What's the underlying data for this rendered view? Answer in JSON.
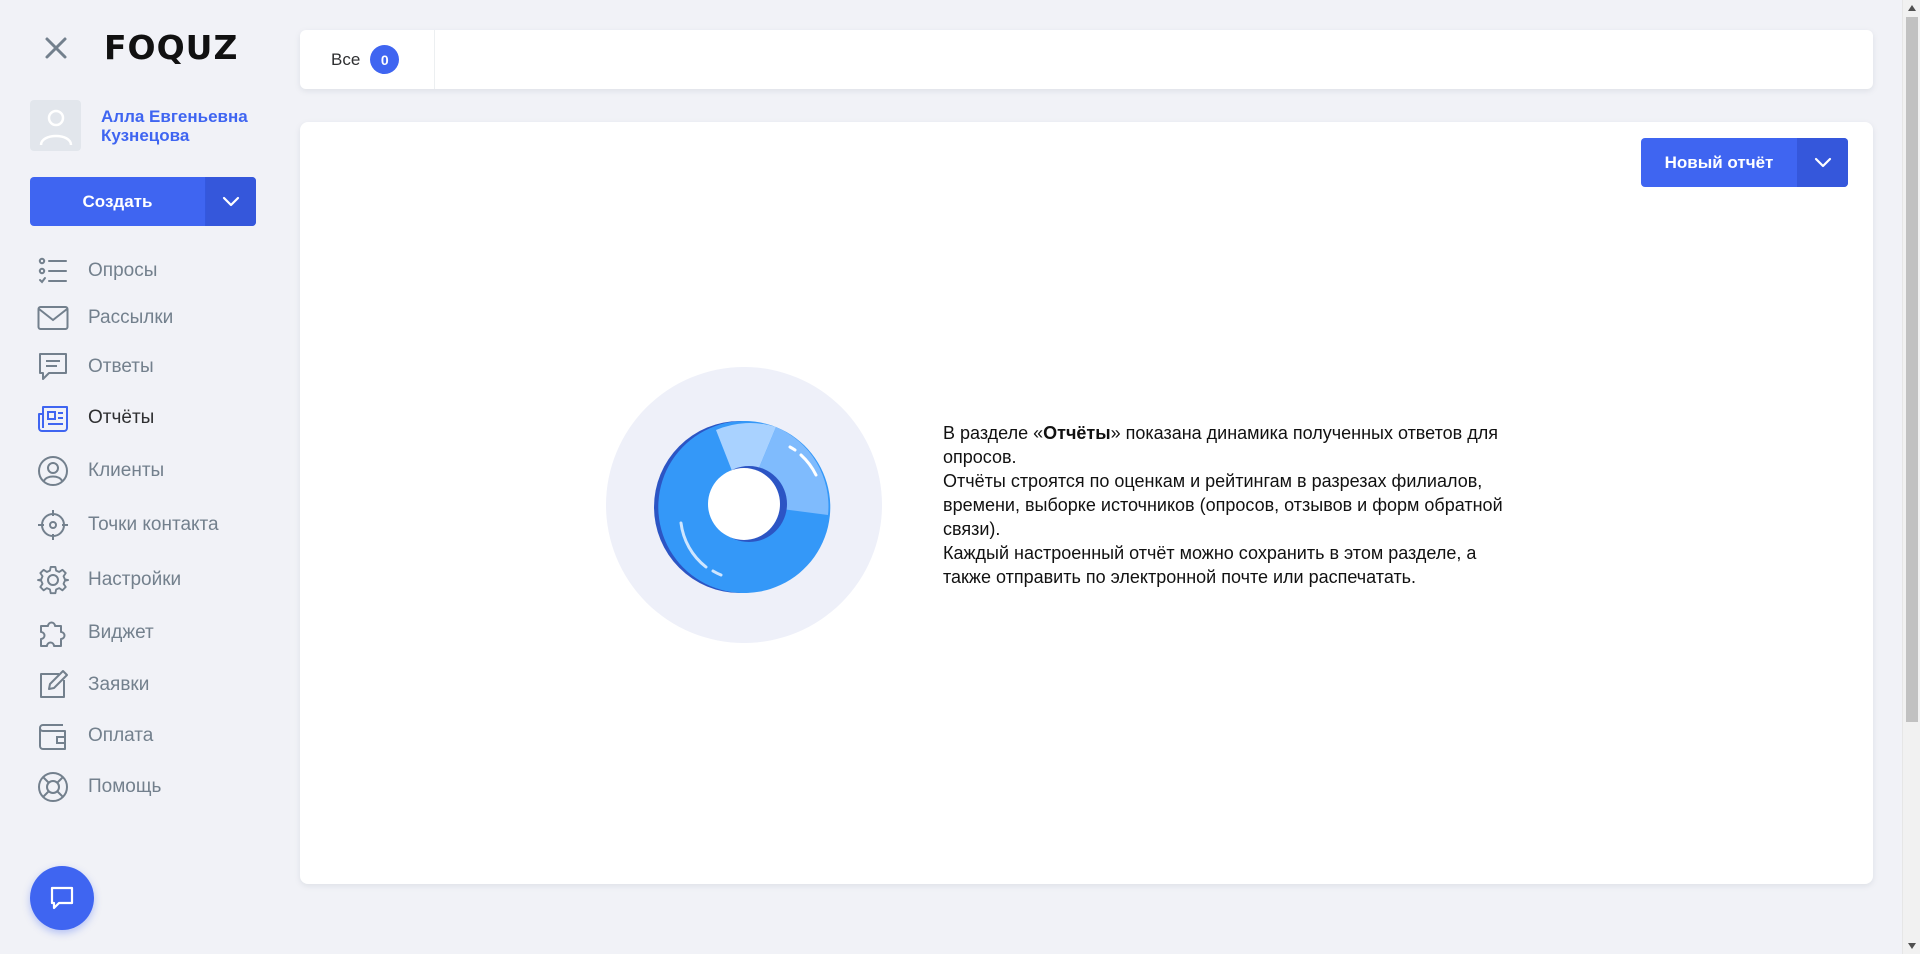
{
  "app": {
    "logo": "FOQUZ"
  },
  "user": {
    "name": "Алла Евгеньевна Кузнецова"
  },
  "create_button": {
    "label": "Создать"
  },
  "nav": {
    "items": [
      {
        "label": "Опросы",
        "icon": "list-check-icon",
        "active": false
      },
      {
        "label": "Рассылки",
        "icon": "mail-icon",
        "active": false
      },
      {
        "label": "Ответы",
        "icon": "message-icon",
        "active": false
      },
      {
        "label": "Отчёты",
        "icon": "report-icon",
        "active": true
      },
      {
        "label": "Клиенты",
        "icon": "user-circle-icon",
        "active": false
      },
      {
        "label": "Точки контакта",
        "icon": "target-icon",
        "active": false
      },
      {
        "label": "Настройки",
        "icon": "gear-icon",
        "active": false
      },
      {
        "label": "Виджет",
        "icon": "puzzle-icon",
        "active": false
      },
      {
        "label": "Заявки",
        "icon": "edit-icon",
        "active": false
      },
      {
        "label": "Оплата",
        "icon": "wallet-icon",
        "active": false
      },
      {
        "label": "Помощь",
        "icon": "lifebuoy-icon",
        "active": false
      }
    ]
  },
  "tabs": [
    {
      "label": "Все",
      "count": "0"
    }
  ],
  "new_report_button": {
    "label": "Новый отчёт"
  },
  "empty_state": {
    "line1_prefix": "В разделе «",
    "line1_bold": "Отчёты",
    "line1_suffix": "» показана динамика полученных ответов для опросов.",
    "line2": "Отчёты строятся по оценкам и рейтингам в разрезах филиалов, времени, выборке источников (опросов, отзывов и форм обратной связи).",
    "line3": "Каждый настроенный отчёт можно сохранить в этом разделе, а также отправить по электронной почте или распечатать."
  },
  "colors": {
    "accent": "#3f65f1",
    "nav_text": "#73808d",
    "background": "#f1f2f7"
  }
}
